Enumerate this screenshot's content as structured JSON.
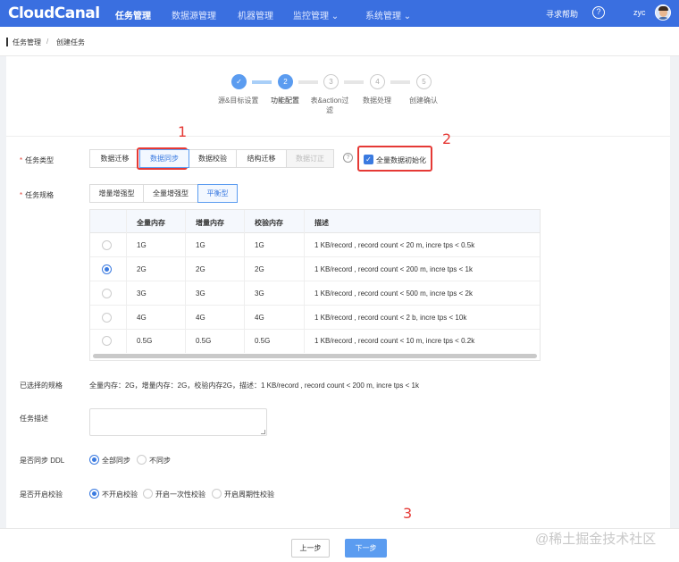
{
  "nav": {
    "logo": "CloudCanal",
    "items": [
      {
        "label": "任务管理",
        "active": true
      },
      {
        "label": "数据源管理",
        "active": false
      },
      {
        "label": "机器管理",
        "active": false
      },
      {
        "label": "监控管理 ⌄",
        "active": false
      },
      {
        "label": "系统管理 ⌄",
        "active": false
      }
    ],
    "help": "寻求帮助",
    "help_icon": "?",
    "user": "zyc"
  },
  "breadcrumb": [
    "任务管理",
    "/",
    "创建任务"
  ],
  "steps": [
    {
      "num": "✓",
      "label": "源&目标设置",
      "state": "done"
    },
    {
      "num": "2",
      "label": "功能配置",
      "state": "current"
    },
    {
      "num": "3",
      "label": "表&action过滤",
      "state": "todo"
    },
    {
      "num": "4",
      "label": "数据处理",
      "state": "todo"
    },
    {
      "num": "5",
      "label": "创建确认",
      "state": "todo"
    }
  ],
  "form": {
    "task_type_label": "任务类型",
    "task_types": [
      "数据迁移",
      "数据同步",
      "数据校验",
      "结构迁移",
      "数据订正"
    ],
    "task_type_selected": "数据同步",
    "help_icon": "?",
    "full_init_label": "全量数据初始化",
    "full_init_checked": true,
    "spec_label": "任务规格",
    "spec_types": [
      "增量增强型",
      "全量增强型",
      "平衡型"
    ],
    "spec_selected": "平衡型",
    "table": {
      "headers": [
        "全量内存",
        "增量内存",
        "校验内存",
        "描述"
      ],
      "rows": [
        {
          "full": "1G",
          "incr": "1G",
          "check": "1G",
          "desc": "1 KB/record , record count < 20 m, incre tps < 0.5k",
          "selected": false
        },
        {
          "full": "2G",
          "incr": "2G",
          "check": "2G",
          "desc": "1 KB/record , record count < 200 m, incre tps < 1k",
          "selected": true
        },
        {
          "full": "3G",
          "incr": "3G",
          "check": "3G",
          "desc": "1 KB/record , record count < 500 m, incre tps < 2k",
          "selected": false
        },
        {
          "full": "4G",
          "incr": "4G",
          "check": "4G",
          "desc": "1 KB/record , record count < 2 b, incre tps < 10k",
          "selected": false
        },
        {
          "full": "0.5G",
          "incr": "0.5G",
          "check": "0.5G",
          "desc": "1 KB/record , record count < 10 m, incre tps < 0.2k",
          "selected": false
        }
      ]
    },
    "selected_spec_label": "已选择的规格",
    "selected_spec_value": "全量内存：2G，增量内存：2G，校验内存2G，描述：1 KB/record , record count < 200 m, incre tps < 1k",
    "desc_label": "任务描述",
    "desc_value": "",
    "ddl_label": "是否同步 DDL",
    "ddl_options": [
      "全部同步",
      "不同步"
    ],
    "ddl_selected": "全部同步",
    "check_label": "是否开启校验",
    "check_options": [
      "不开启校验",
      "开启一次性校验",
      "开启周期性校验"
    ],
    "check_selected": "不开启校验"
  },
  "annotations": [
    "1",
    "2",
    "3"
  ],
  "footer": {
    "prev": "上一步",
    "next": "下一步"
  },
  "watermark": "@稀土掘金技术社区"
}
